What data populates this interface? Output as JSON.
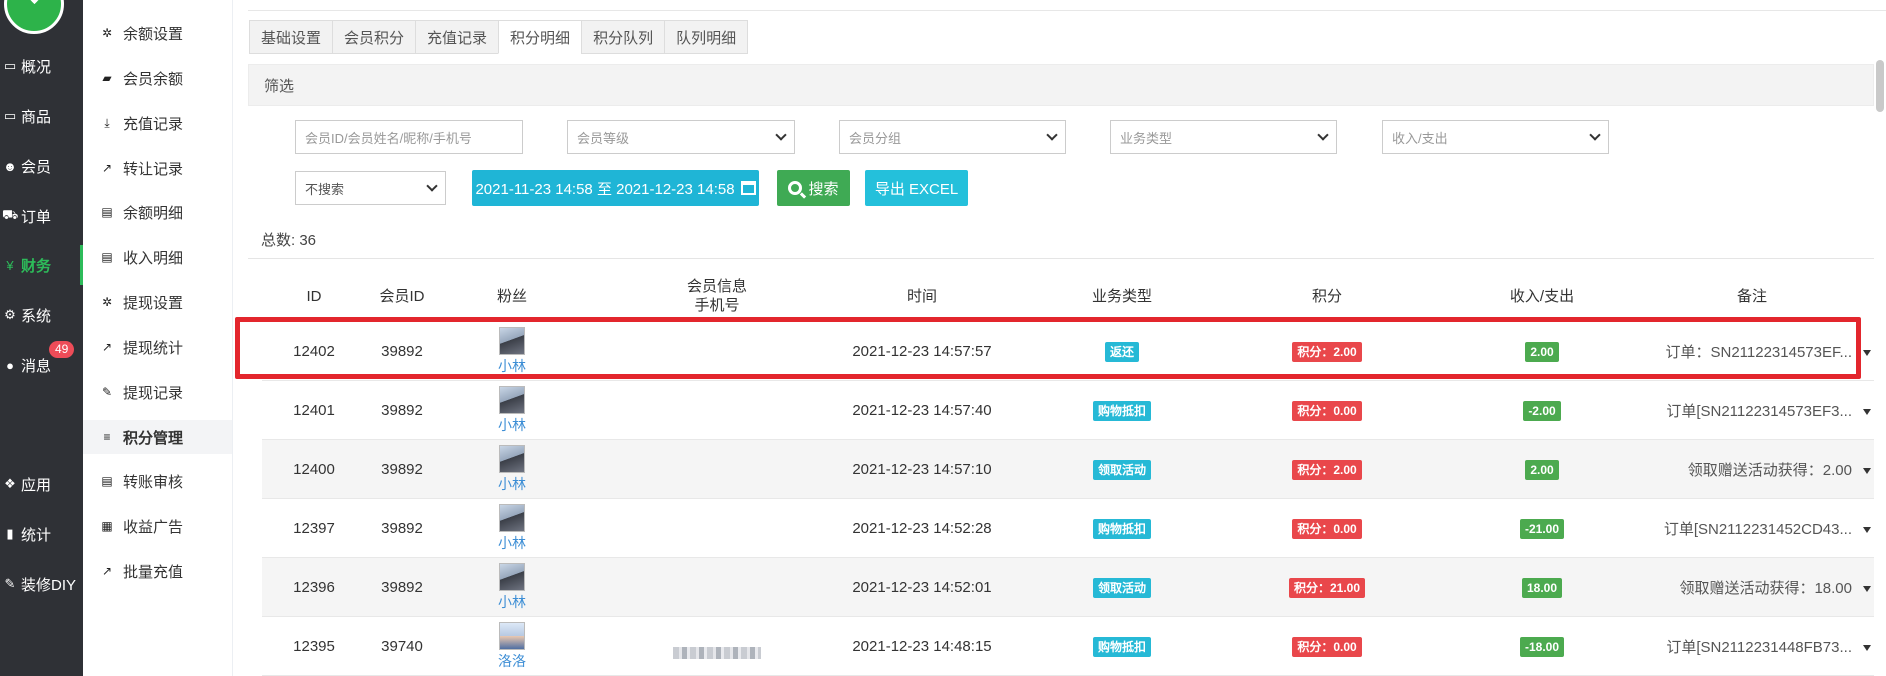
{
  "nav": [
    {
      "label": "概况",
      "icon": "monitor-icon",
      "glyph": "▭"
    },
    {
      "label": "商品",
      "icon": "monitor-icon",
      "glyph": "▭"
    },
    {
      "label": "会员",
      "icon": "users-icon",
      "glyph": "👥"
    },
    {
      "label": "订单",
      "icon": "cart-icon",
      "glyph": "🛒"
    },
    {
      "label": "财务",
      "icon": "yen-icon",
      "glyph": "¥"
    },
    {
      "label": "系统",
      "icon": "gears-icon",
      "glyph": "⚙"
    },
    {
      "label": "消息",
      "icon": "chat-icon",
      "glyph": "💬",
      "badge": "49"
    },
    {
      "label": "应用",
      "icon": "cubes-icon",
      "glyph": "❖"
    },
    {
      "label": "统计",
      "icon": "bar-chart-icon",
      "glyph": "▮"
    },
    {
      "label": "装修DIY",
      "icon": "wrench-icon",
      "glyph": "🔧"
    }
  ],
  "subnav": [
    {
      "label": "余额设置",
      "icon": "gear-icon",
      "glyph": "✲"
    },
    {
      "label": "会员余额",
      "icon": "book-icon",
      "glyph": "▰"
    },
    {
      "label": "充值记录",
      "icon": "download-icon",
      "glyph": "⤓"
    },
    {
      "label": "转让记录",
      "icon": "external-link-icon",
      "glyph": "↗"
    },
    {
      "label": "余额明细",
      "icon": "file-icon",
      "glyph": "▤"
    },
    {
      "label": "收入明细",
      "icon": "file-icon",
      "glyph": "▤"
    },
    {
      "label": "提现设置",
      "icon": "gear-icon",
      "glyph": "✲"
    },
    {
      "label": "提现统计",
      "icon": "line-chart-icon",
      "glyph": "↗"
    },
    {
      "label": "提现记录",
      "icon": "pencil-icon",
      "glyph": "✎"
    },
    {
      "label": "积分管理",
      "icon": "database-icon",
      "glyph": "≡"
    },
    {
      "label": "转账审核",
      "icon": "file-icon",
      "glyph": "▤"
    },
    {
      "label": "收益广告",
      "icon": "image-icon",
      "glyph": "▦"
    },
    {
      "label": "批量充值",
      "icon": "line-chart-icon",
      "glyph": "↗"
    }
  ],
  "tabs": [
    "基础设置",
    "会员积分",
    "充值记录",
    "积分明细",
    "积分队列",
    "队列明细"
  ],
  "active_tab": "积分明细",
  "filter": {
    "title": "筛选",
    "member_placeholder": "会员ID/会员姓名/昵称/手机号",
    "level": "会员等级",
    "group": "会员分组",
    "biz_type": "业务类型",
    "income": "收入/支出",
    "search_mode": "不搜索",
    "date_range": "2021-11-23 14:58 至 2021-12-23 14:58",
    "search_btn": "搜索",
    "export_btn": "导出 EXCEL"
  },
  "total_label": "总数:",
  "total_value": "36",
  "columns": {
    "id": "ID",
    "member_id": "会员ID",
    "fans": "粉丝",
    "info_line1": "会员信息",
    "info_line2": "手机号",
    "time": "时间",
    "biz": "业务类型",
    "points": "积分",
    "inout": "收入/支出",
    "note": "备注"
  },
  "rows": [
    {
      "id": "12402",
      "member_id": "39892",
      "nick": "小林",
      "phone_masked": false,
      "time": "2021-12-23 14:57:57",
      "biz": "返还",
      "points": "积分：2.00",
      "inout": "2.00",
      "note": "订单：SN21122314573EF..."
    },
    {
      "id": "12401",
      "member_id": "39892",
      "nick": "小林",
      "phone_masked": false,
      "time": "2021-12-23 14:57:40",
      "biz": "购物抵扣",
      "points": "积分：0.00",
      "inout": "-2.00",
      "note": "订单[SN21122314573EF3..."
    },
    {
      "id": "12400",
      "member_id": "39892",
      "nick": "小林",
      "phone_masked": false,
      "time": "2021-12-23 14:57:10",
      "biz": "领取活动",
      "points": "积分：2.00",
      "inout": "2.00",
      "note": "领取赠送活动获得：2.00"
    },
    {
      "id": "12397",
      "member_id": "39892",
      "nick": "小林",
      "phone_masked": false,
      "time": "2021-12-23 14:52:28",
      "biz": "购物抵扣",
      "points": "积分：0.00",
      "inout": "-21.00",
      "note": "订单[SN2112231452CD43..."
    },
    {
      "id": "12396",
      "member_id": "39892",
      "nick": "小林",
      "phone_masked": false,
      "time": "2021-12-23 14:52:01",
      "biz": "领取活动",
      "points": "积分：21.00",
      "inout": "18.00",
      "note": "领取赠送活动获得：18.00"
    },
    {
      "id": "12395",
      "member_id": "39740",
      "nick": "洛洛",
      "phone_masked": true,
      "time": "2021-12-23 14:48:15",
      "biz": "购物抵扣",
      "points": "积分：0.00",
      "inout": "-18.00",
      "note": "订单[SN2112231448FB73..."
    }
  ],
  "colors": {
    "nav_bg": "#2f3136",
    "accent_green": "#2dbb5a",
    "label_blue": "#26b9d6",
    "label_red": "#e9474b",
    "label_green": "#4caa4f",
    "highlight": "#e3262d"
  }
}
